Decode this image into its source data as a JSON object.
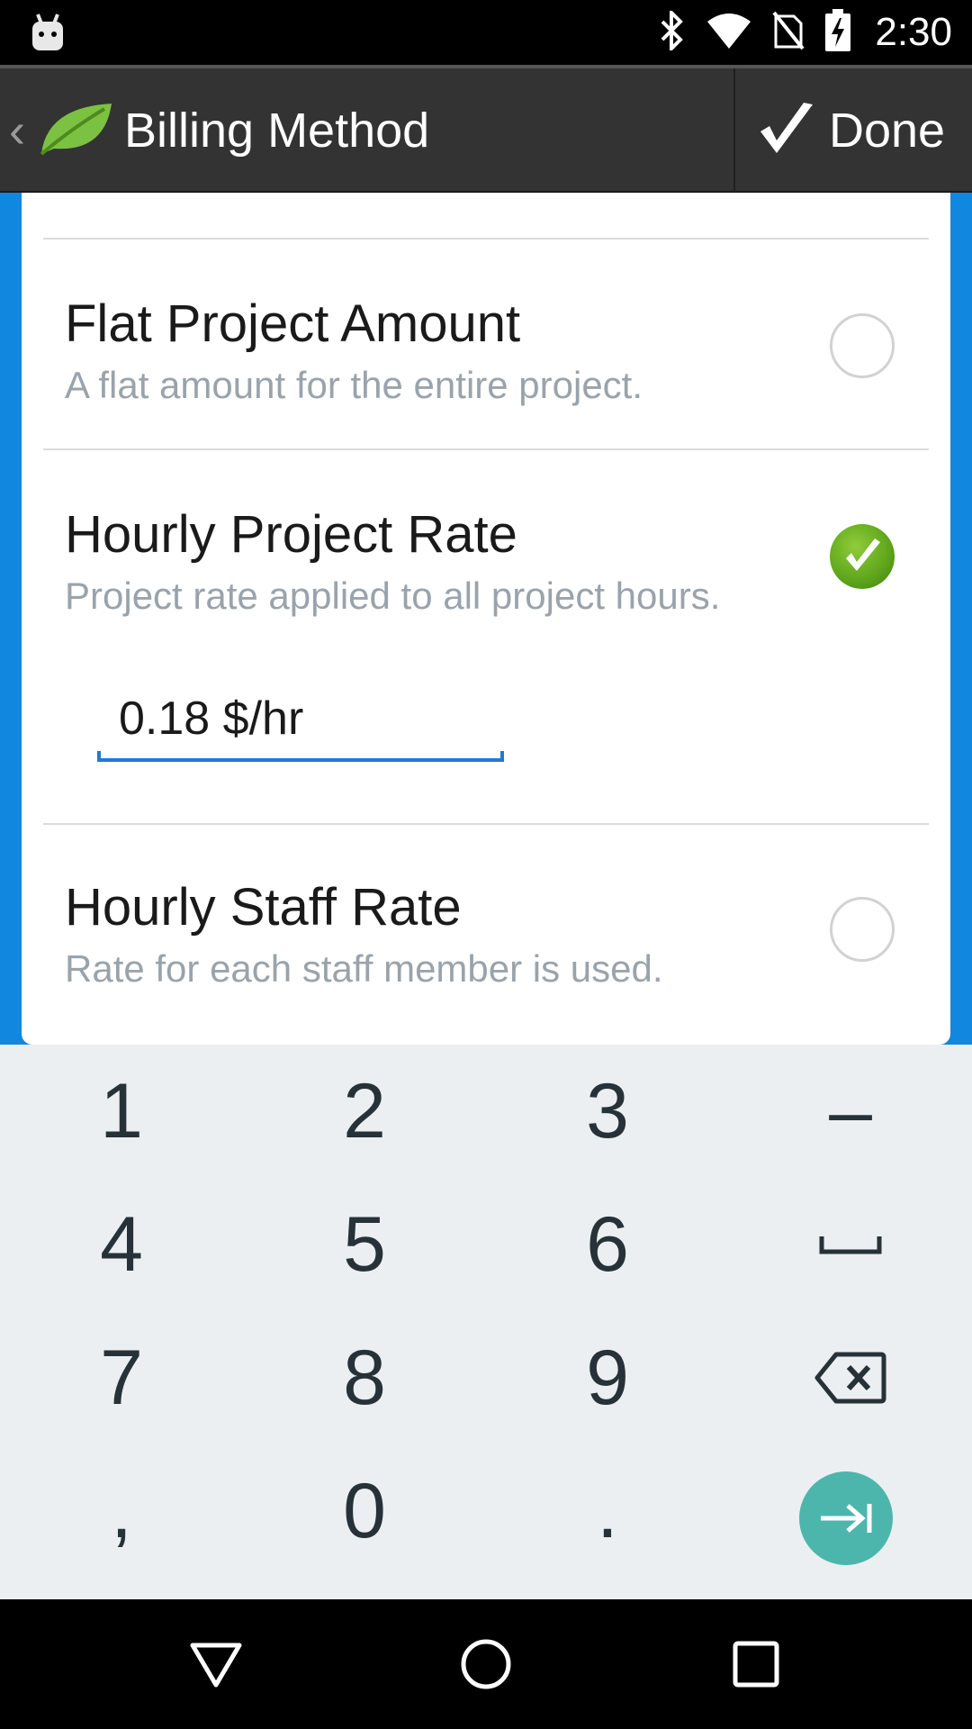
{
  "status_bar": {
    "time": "2:30",
    "icons": [
      "android-notification-icon",
      "bluetooth-icon",
      "wifi-icon",
      "no-sim-icon",
      "battery-charging-icon"
    ]
  },
  "action_bar": {
    "title": "Billing Method",
    "done_label": "Done",
    "app_icon": "leaf-icon"
  },
  "options": [
    {
      "title": "Flat Project Amount",
      "description": "A flat amount for the entire project.",
      "selected": false
    },
    {
      "title": "Hourly Project Rate",
      "description": "Project rate applied to all project hours.",
      "selected": true,
      "rate_value": "0.18 $/hr"
    },
    {
      "title": "Hourly Staff Rate",
      "description": "Rate for each staff member is used.",
      "selected": false
    }
  ],
  "keypad": {
    "keys": [
      "1",
      "2",
      "3",
      "–",
      "4",
      "5",
      "6",
      "space",
      "7",
      "8",
      "9",
      "backspace",
      ",",
      "0",
      ".",
      "next"
    ]
  },
  "colors": {
    "accent_blue": "#1287e0",
    "check_green": "#5ea41b",
    "keypad_go": "#4db6ac"
  },
  "nav_bar": {
    "buttons": [
      "back-icon",
      "home-icon",
      "recents-icon"
    ]
  }
}
